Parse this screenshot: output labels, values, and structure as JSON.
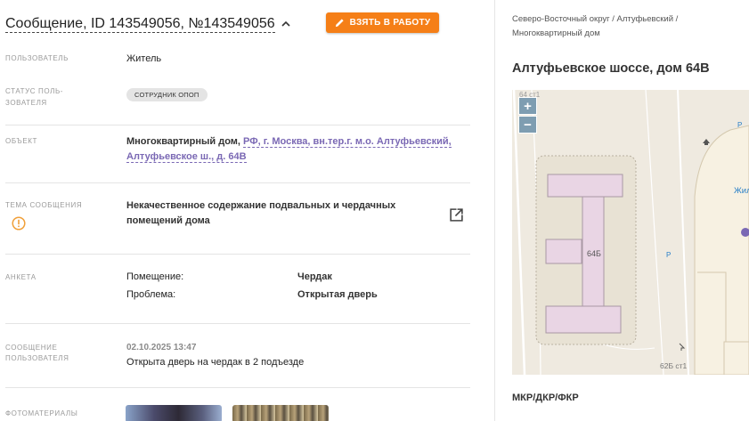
{
  "header": {
    "title": "Сообщение, ID 143549056, №143549056",
    "take_button": "ВЗЯТЬ В РАБОТУ"
  },
  "fields": {
    "user": {
      "label": "ПОЛЬЗОВАТЕЛЬ",
      "value": "Житель"
    },
    "user_status": {
      "label_line1": "СТАТУС ПОЛЬ-",
      "label_line2": "ЗОВАТЕЛЯ",
      "badge": "СОТРУДНИК ОПОП"
    },
    "object": {
      "label": "ОБЪЕКТ",
      "type": "Многоквартирный дом,",
      "link_line1": "РФ, г. Москва, вн.тер.г. м.о. Алтуфьевский,",
      "link_line2": "Алтуфьевское ш., д. 64В"
    },
    "topic": {
      "label": "ТЕМА СООБЩЕНИЯ",
      "line1": "Некачественное содержание подвальных и чердачных",
      "line2": "помещений дома"
    },
    "survey": {
      "label": "АНКЕТА",
      "rows": [
        {
          "key": "Помещение:",
          "value": "Чердак"
        },
        {
          "key": "Проблема:",
          "value": "Открытая дверь"
        }
      ]
    },
    "user_message": {
      "label_line1": "СООБЩЕНИЕ",
      "label_line2": "ПОЛЬЗОВАТЕЛЯ",
      "date": "02.10.2025 13:47",
      "text": "Открыта дверь на чердак в 2 подъезде"
    },
    "photos": {
      "label": "ФОТОМАТЕРИАЛЫ"
    }
  },
  "sidebar": {
    "breadcrumb_line1": "Северо-Восточный округ / Алтуфьевский /",
    "breadcrumb_line2": "Многоквартирный дом",
    "address": "Алтуфьевское шоссе, дом 64В",
    "map": {
      "zoom_in": "+",
      "zoom_out": "−",
      "label_top": "64 ст1",
      "label_building": "64Б",
      "label_bottom": "62Б ст1",
      "label_right": "Жил",
      "parking_1": "P",
      "parking_2": "P"
    },
    "bottom_label": "МКР/ДКР/ФКР"
  },
  "colors": {
    "accent": "#f57f17",
    "link": "#7a68b4",
    "warning": "#f0a03a",
    "map_building": "#e9d5e4"
  },
  "icons": {
    "collapse": "chevron-up-icon",
    "edit": "pencil-icon",
    "warning": "warning-icon",
    "open": "open-external-icon"
  }
}
